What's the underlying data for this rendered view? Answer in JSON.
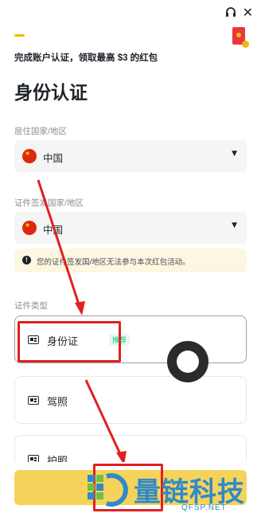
{
  "header": {
    "support_icon": "headset-icon",
    "close_icon": "close-icon",
    "close_glyph": "✕",
    "reward_icon": "red-packet-icon"
  },
  "promo_text": "完成账户认证，领取最高 $3 的红包",
  "page_title": "身份认证",
  "residence": {
    "label": "居住国家/地区",
    "value": "中国",
    "flag": "china-flag-icon"
  },
  "issuing": {
    "label": "证件签发国家/地区",
    "value": "中国",
    "flag": "china-flag-icon"
  },
  "notice": {
    "icon": "!",
    "text": "您的证件签发国/地区无法参与本次红包活动。"
  },
  "id_type": {
    "label": "证件类型",
    "options": [
      {
        "label": "身份证",
        "badge": "推荐",
        "icon": "id-card-icon"
      },
      {
        "label": "驾照",
        "icon": "id-card-icon"
      },
      {
        "label": "护照",
        "icon": "passport-icon"
      }
    ]
  },
  "caret_glyph": "▼",
  "watermark": {
    "title": "量链科技",
    "url": "QFSP.NET"
  },
  "colors": {
    "accent": "#f0b90b",
    "annotation_red": "#e02020",
    "badge_green": "#0ecb81",
    "watermark_blue": "#2f8ac8"
  }
}
